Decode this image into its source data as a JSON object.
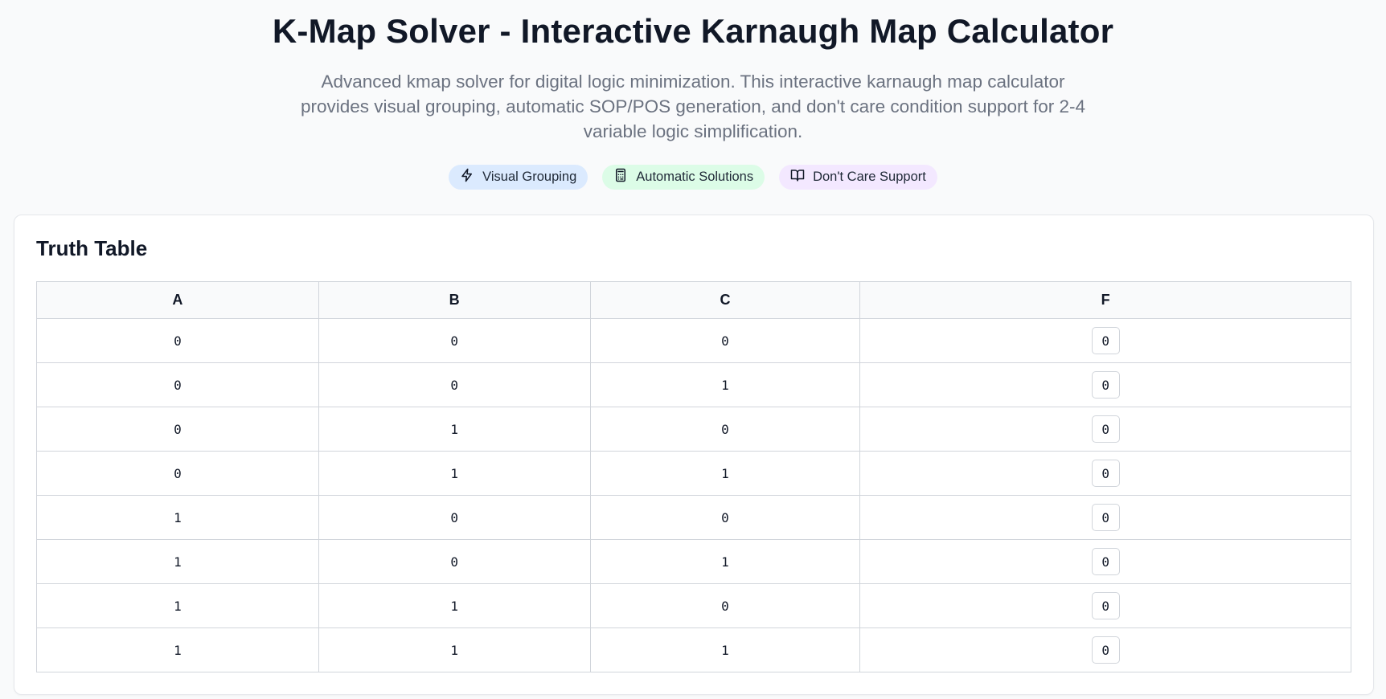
{
  "hero": {
    "title": "K-Map Solver - Interactive Karnaugh Map Calculator",
    "description": "Advanced kmap solver for digital logic minimization. This interactive karnaugh map calculator provides visual grouping, automatic SOP/POS generation, and don't care condition support for 2-4 variable logic simplification."
  },
  "badges": [
    {
      "label": "Visual Grouping",
      "icon": "lightning-icon",
      "color": "#dbeafe"
    },
    {
      "label": "Automatic Solutions",
      "icon": "calculator-icon",
      "color": "#dcfce7"
    },
    {
      "label": "Don't Care Support",
      "icon": "book-icon",
      "color": "#f3e8ff"
    }
  ],
  "truth_table": {
    "title": "Truth Table",
    "headers": [
      "A",
      "B",
      "C",
      "F"
    ],
    "rows": [
      [
        "0",
        "0",
        "0",
        "0"
      ],
      [
        "0",
        "0",
        "1",
        "0"
      ],
      [
        "0",
        "1",
        "0",
        "0"
      ],
      [
        "0",
        "1",
        "1",
        "0"
      ],
      [
        "1",
        "0",
        "0",
        "0"
      ],
      [
        "1",
        "0",
        "1",
        "0"
      ],
      [
        "1",
        "1",
        "0",
        "0"
      ],
      [
        "1",
        "1",
        "1",
        "0"
      ]
    ]
  }
}
